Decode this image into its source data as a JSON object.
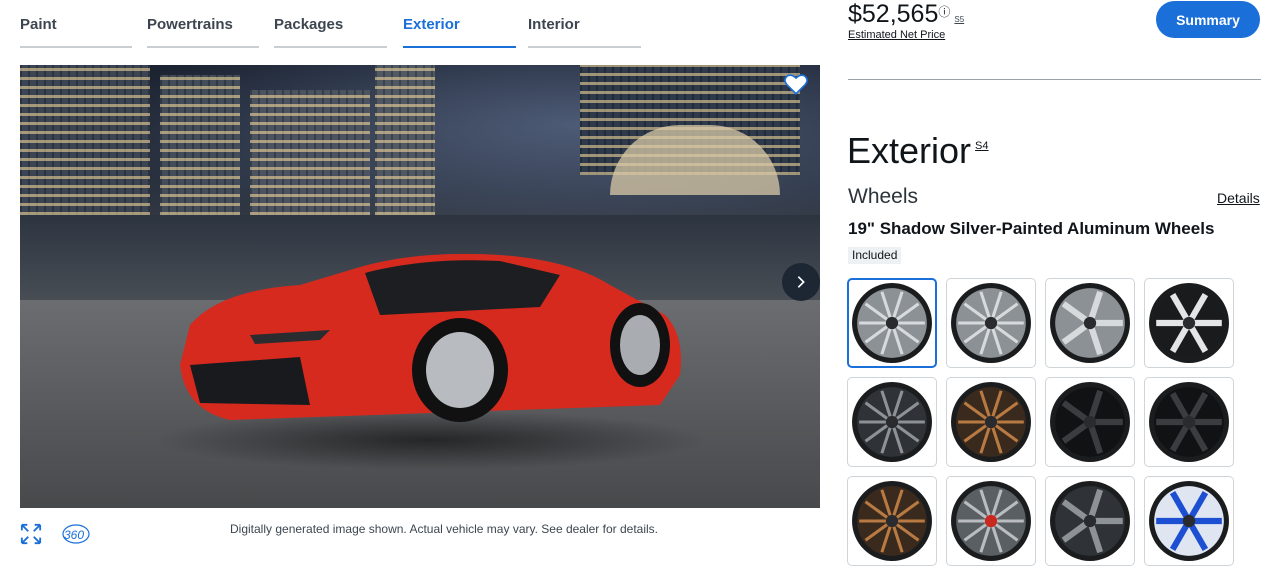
{
  "tabs": [
    {
      "label": "Paint"
    },
    {
      "label": "Powertrains"
    },
    {
      "label": "Packages"
    },
    {
      "label": "Exterior",
      "active": true
    },
    {
      "label": "Interior"
    }
  ],
  "header": {
    "price": "$52,565",
    "price_footnote": "S5",
    "price_sub": "Estimated Net Price",
    "summary_label": "Summary"
  },
  "section": {
    "title": "Exterior",
    "title_footnote": "S4",
    "subsection": "Wheels",
    "details_label": "Details",
    "selected_name": "19\" Shadow Silver-Painted Aluminum Wheels",
    "selected_status": "Included"
  },
  "viewer": {
    "disclaimer": "Digitally generated image shown. Actual vehicle may vary. See dealer for details.",
    "icons": [
      "heart-icon",
      "chevron-right-icon",
      "expand-icon",
      "rotate-360-icon"
    ]
  },
  "wheels": [
    {
      "finish": "silver",
      "style": "split-10",
      "selected": true
    },
    {
      "finish": "silver",
      "style": "mesh"
    },
    {
      "finish": "silver",
      "style": "5-spoke-twin"
    },
    {
      "finish": "black-machined",
      "style": "y-spoke"
    },
    {
      "finish": "gray",
      "style": "mesh-dark"
    },
    {
      "finish": "bronze",
      "style": "split-10"
    },
    {
      "finish": "black",
      "style": "5-spoke-twin"
    },
    {
      "finish": "black",
      "style": "y-spoke"
    },
    {
      "finish": "bronze",
      "style": "mesh"
    },
    {
      "finish": "silver-dark",
      "style": "split-10-red-center"
    },
    {
      "finish": "gray",
      "style": "5-spoke-twin"
    },
    {
      "finish": "blue",
      "style": "y-spoke"
    }
  ],
  "colors": {
    "accent": "#1a6fd8",
    "car_red": "#d62a1f"
  }
}
